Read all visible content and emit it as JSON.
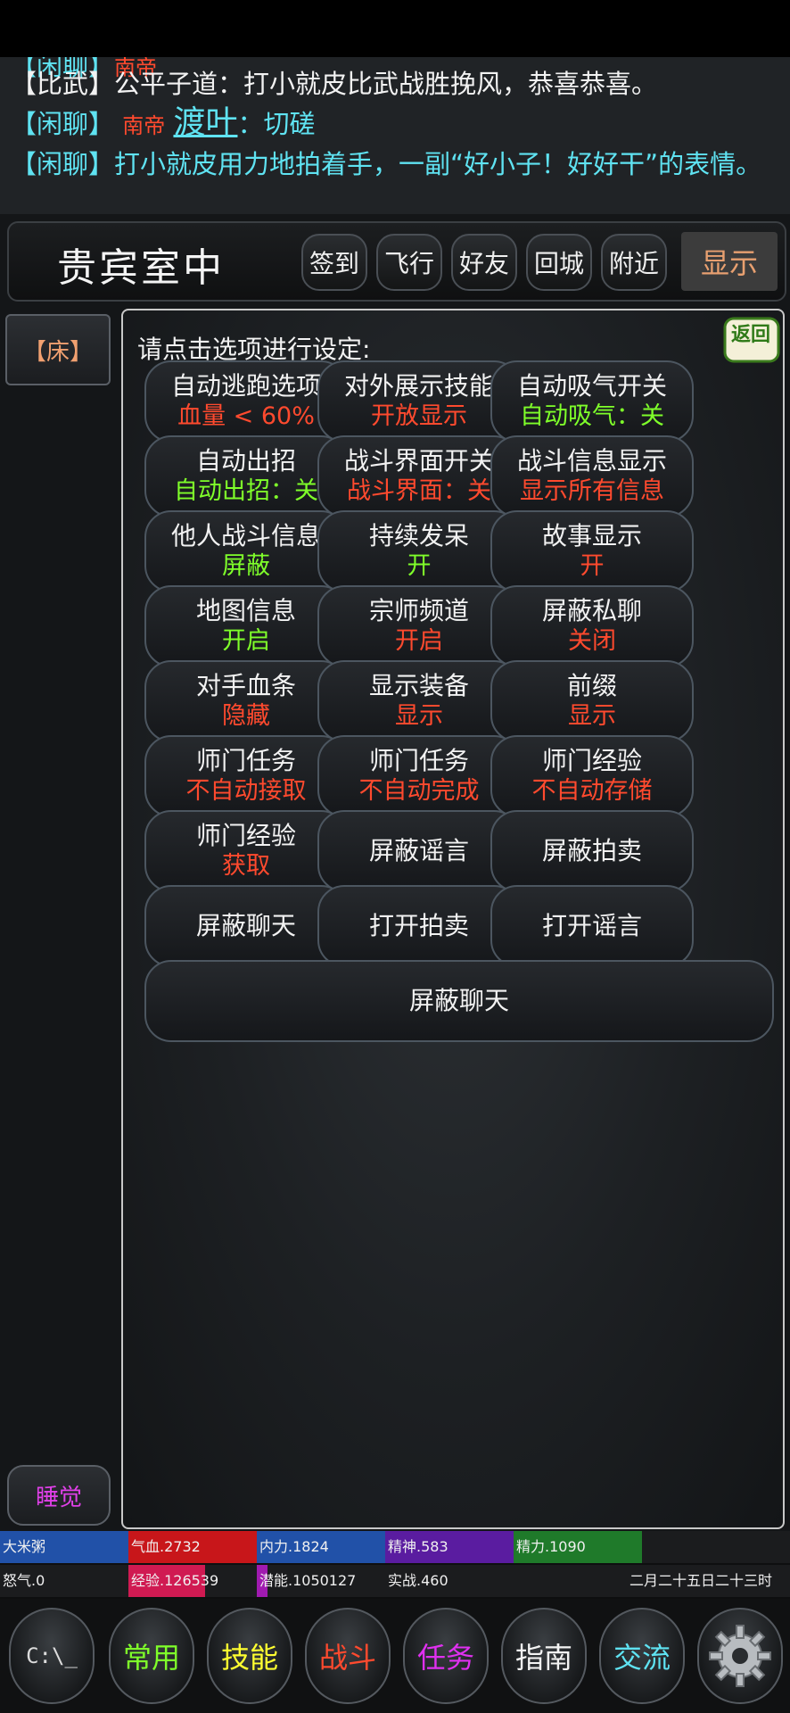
{
  "chat": {
    "line0": {
      "tag": "【闲聊】",
      "rest": "南帝 "
    },
    "line1": {
      "tag": "【比武】",
      "text": "公平子道：打小就皮比武战胜挽风，恭喜恭喜。"
    },
    "line2": {
      "tag": "【闲聊】",
      "title": "南帝",
      "name": "渡叶",
      "text": "：切磋"
    },
    "line3": {
      "tag": "【闲聊】",
      "text": "打小就皮用力地拍着手，一副“好小子！好好干”的表情。"
    }
  },
  "location": {
    "title": "贵宾室中",
    "buttons": [
      "签到",
      "飞行",
      "好友",
      "回城",
      "附近"
    ],
    "show_label": "显示"
  },
  "left": {
    "bed": "【床】",
    "sleep": "睡觉"
  },
  "panel": {
    "hint": "请点击选项进行设定:",
    "return_label": "返回",
    "options": [
      {
        "l1": "自动逃跑选项",
        "l2": "血量 < 60%"
      },
      {
        "l1": "对外展示技能",
        "l2": "开放显示"
      },
      {
        "l1": "自动吸气开关",
        "l2": "自动吸气：关"
      },
      {
        "l1": "自动出招",
        "l2": "自动出招：关"
      },
      {
        "l1": "战斗界面开关",
        "l2": "战斗界面：关"
      },
      {
        "l1": "战斗信息显示",
        "l2": "显示所有信息"
      },
      {
        "l1": "他人战斗信息",
        "l2": "屏蔽"
      },
      {
        "l1": "持续发呆",
        "l2": "开"
      },
      {
        "l1": "故事显示",
        "l2": "开"
      },
      {
        "l1": "地图信息",
        "l2": "开启"
      },
      {
        "l1": "宗师频道",
        "l2": "开启"
      },
      {
        "l1": "屏蔽私聊",
        "l2": "关闭"
      },
      {
        "l1": "对手血条",
        "l2": "隐藏"
      },
      {
        "l1": "显示装备",
        "l2": "显示"
      },
      {
        "l1": "前缀",
        "l2": "显示"
      },
      {
        "l1": "师门任务",
        "l2": "不自动接取"
      },
      {
        "l1": "师门任务",
        "l2": "不自动完成"
      },
      {
        "l1": "师门经验",
        "l2": "不自动存储"
      },
      {
        "l1": "师门经验",
        "l2": "获取"
      },
      {
        "l1": "屏蔽谣言"
      },
      {
        "l1": "屏蔽拍卖"
      },
      {
        "l1": "屏蔽聊天"
      },
      {
        "l1": "打开拍卖"
      },
      {
        "l1": "打开谣言"
      },
      {
        "l1": "屏蔽聊天"
      }
    ]
  },
  "stats": {
    "row1": [
      "大米粥",
      "气血.2732",
      "内力.1824",
      "精神.583",
      "精力.1090"
    ],
    "row2": [
      "怒气.0",
      "经验.126539",
      "潜能.1050127",
      "实战.460",
      "二月二十五日二十三时"
    ],
    "fills": {
      "qixue": 1.0,
      "neili": 1.0,
      "jingshen": 1.0,
      "jingli": 1.0,
      "jingyan": 0.6,
      "qianneng": 0.08
    }
  },
  "nav": {
    "console": "C:\\_",
    "items": [
      "常用",
      "技能",
      "战斗",
      "任务",
      "指南",
      "交流"
    ]
  },
  "colors": {
    "red_status": "#ff4a2e",
    "green_status": "#7fff2a",
    "cyan": "#5fe3f2"
  }
}
